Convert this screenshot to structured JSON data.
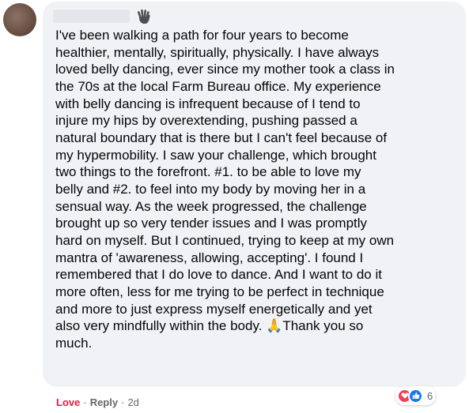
{
  "comment": {
    "author_name": "",
    "lines": [
      "I've been walking a path for four years to become",
      "healthier, mentally, spiritually, physically. I have always",
      "loved belly dancing, ever since my mother took a class in",
      "the 70s at the local Farm Bureau office. My experience",
      "with belly dancing is infrequent because of I tend to",
      "injure my hips by overextending, pushing passed a",
      "natural boundary that is there but I can't feel because of",
      "my hypermobility. I saw your challenge, which brought",
      "two things to the forefront. #1. to be able to love my",
      "belly and #2. to feel into my body by moving her in a",
      "sensual way. As the week progressed, the challenge",
      "brought up so very tender issues and I was promptly",
      "hard on myself. But I continued, trying to keep at my own",
      "mantra of 'awareness, allowing, accepting'. I found I",
      "remembered that I do love to dance. And I want to do it",
      "more often, less for me trying to be perfect in technique",
      "and more to just express myself energetically and yet"
    ],
    "last_line_before_emoji": "also very mindfully within the body. ",
    "emoji": "🙏",
    "last_line_after_emoji": "Thank you so",
    "final_line": "much."
  },
  "reactions": {
    "icons": [
      "love-icon",
      "like-icon"
    ],
    "count": "6"
  },
  "actions": {
    "love_label": "Love",
    "separator": "·",
    "reply_label": "Reply",
    "timestamp": "2d"
  },
  "colors": {
    "bubble": "#f0f2f5",
    "text": "#050505",
    "love": "#e41e3f",
    "like": "#1877f2",
    "muted": "#65676b"
  }
}
